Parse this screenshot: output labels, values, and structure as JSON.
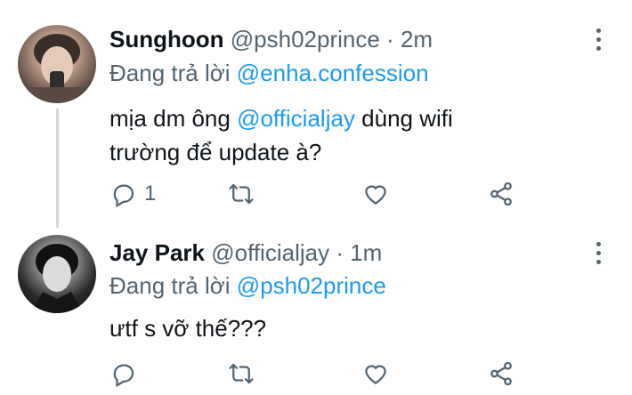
{
  "tweets": [
    {
      "display_name": "Sunghoon",
      "handle": "@psh02prince",
      "separator": "·",
      "time": "2m",
      "reply_prefix": "Đang trả lời",
      "reply_to": "@enha.confession",
      "body_line1_before": "mịa dm ông ",
      "body_mention": "@officialjay",
      "body_line1_after": " dùng wifi",
      "body_line2": "trường để update à?",
      "reply_count": "1",
      "retweet_count": "",
      "like_count": ""
    },
    {
      "display_name": "Jay Park",
      "handle": "@officialjay",
      "separator": "·",
      "time": "1m",
      "reply_prefix": "Đang trả lời",
      "reply_to": "@psh02prince",
      "body_line1": "ưtf s vỡ thế???",
      "reply_count": "",
      "retweet_count": "",
      "like_count": ""
    }
  ],
  "colors": {
    "text": "#0f1419",
    "secondary": "#536471",
    "accent": "#1d9bf0",
    "thread_line": "#cfd9de"
  },
  "icons": [
    "comment-icon",
    "retweet-icon",
    "heart-icon",
    "share-icon",
    "more-icon"
  ]
}
